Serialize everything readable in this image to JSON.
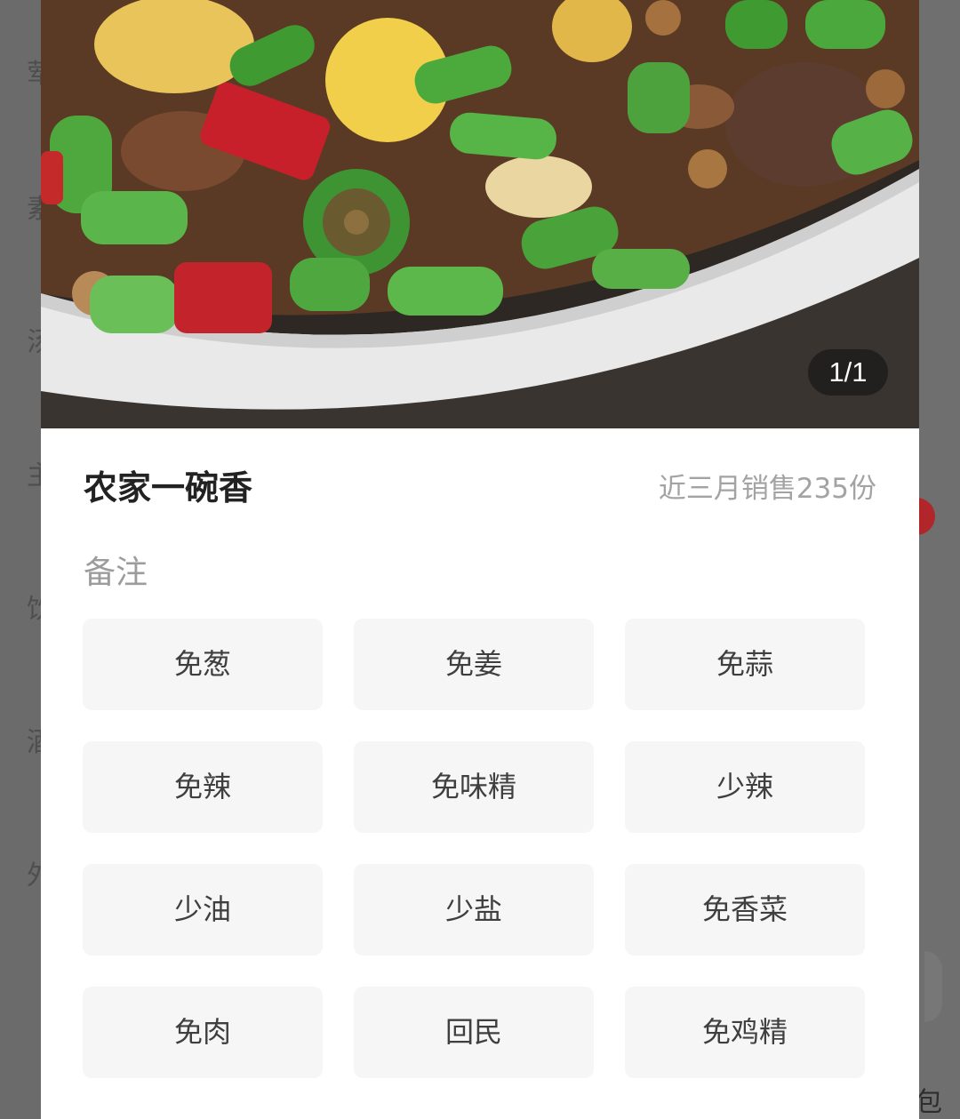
{
  "background": {
    "category_glyphs": [
      "荤",
      "素",
      "汤",
      "主",
      "饮",
      "酒",
      "外"
    ],
    "bottom_right_text": "包"
  },
  "modal": {
    "image_counter": "1/1",
    "dish_name": "农家一碗香",
    "sales": "近三月销售235份",
    "remark_title": "备注",
    "options": [
      "免葱",
      "免姜",
      "免蒜",
      "免辣",
      "免味精",
      "少辣",
      "少油",
      "少盐",
      "免香菜",
      "免肉",
      "回民",
      "免鸡精"
    ]
  },
  "colors": {
    "overlay": "#6f6f6f",
    "accent_red": "#b0262a",
    "option_bg": "#f6f6f6",
    "title_text": "#222222",
    "muted_text": "#a3a3a3"
  }
}
